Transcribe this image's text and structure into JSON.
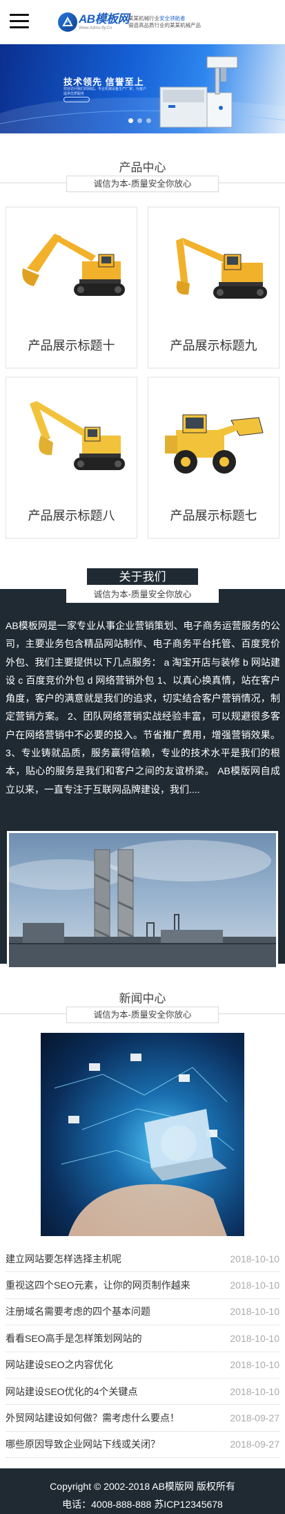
{
  "header": {
    "logo_name": "AB模板网",
    "logo_sub": "Www.Admo-fly.Cn",
    "tagline_line1_prefix": "某某机械行业",
    "tagline_line1_highlight": "安全领航者",
    "tagline_line2": "锻造高品质行业的某某机械产品",
    "colors": {
      "brand": "#1b5fbf",
      "accent": "#1f66c9"
    }
  },
  "banner": {
    "title": "技术领先  信誉至上",
    "subtitle": "欢迎访问我们的网站，专业机械设备生产厂家，为客户提供优质服务",
    "active_slide": 1,
    "slides": 3
  },
  "products_section": {
    "title": "产品中心",
    "slogan": "诚信为本-质量安全你放心",
    "items": [
      {
        "name": "产品展示标题十",
        "image": "excavator"
      },
      {
        "name": "产品展示标题九",
        "image": "excavator"
      },
      {
        "name": "产品展示标题八",
        "image": "excavator"
      },
      {
        "name": "产品展示标题七",
        "image": "wheel-loader"
      }
    ]
  },
  "about_section": {
    "title": "关于我们",
    "slogan": "诚信为本-质量安全你放心",
    "text": "AB模板网是一家专业从事企业营销策划、电子商务运营服务的公司，主要业务包含精品网站制作、电子商务平台托管、百度竞价外包、我们主要提供以下几点服务： a 淘宝开店与装修 b 网站建设 c 百度竞价外包 d 网络营销外包 1、以真心换真情，站在客户角度，客户的满意就是我们的追求，切实结合客户营销情况，制定营销方案。 2、团队网络营销实战经验丰富，可以规避很多客户在网络营销中不必要的投入。节省推广费用，增强营销效果。 3、专业铸就品质，服务赢得信赖，专业的技术水平是我们的根本，贴心的服务是我们和客户之间的友谊桥梁。 AB模版网自成立以来，一直专注于互联网品牌建设，我们....",
    "image": "factory-chimneys"
  },
  "news_section": {
    "title": "新闻中心",
    "slogan": "诚信为本-质量安全你放心",
    "image": "hand-laptop-network",
    "items": [
      {
        "title": "建立网站要怎样选择主机呢",
        "date": "2018-10-10"
      },
      {
        "title": "重视这四个SEO元素，让你的网页制作越来",
        "date": "2018-10-10"
      },
      {
        "title": "注册域名需要考虑的四个基本问题",
        "date": "2018-10-10"
      },
      {
        "title": "看看SEO高手是怎样策划网站的",
        "date": "2018-10-10"
      },
      {
        "title": "网站建设SEO之内容优化",
        "date": "2018-10-10"
      },
      {
        "title": "网站建设SEO优化的4个关键点",
        "date": "2018-10-10"
      },
      {
        "title": "外贸网站建设如何做？需考虑什么要点！",
        "date": "2018-09-27"
      },
      {
        "title": "哪些原因导致企业网站下线或关闭？",
        "date": "2018-09-27"
      }
    ]
  },
  "footer": {
    "copyright": "Copyright © 2002-2018 AB模版网 版权所有",
    "contact": "电话：4008-888-888    苏ICP12345678"
  }
}
